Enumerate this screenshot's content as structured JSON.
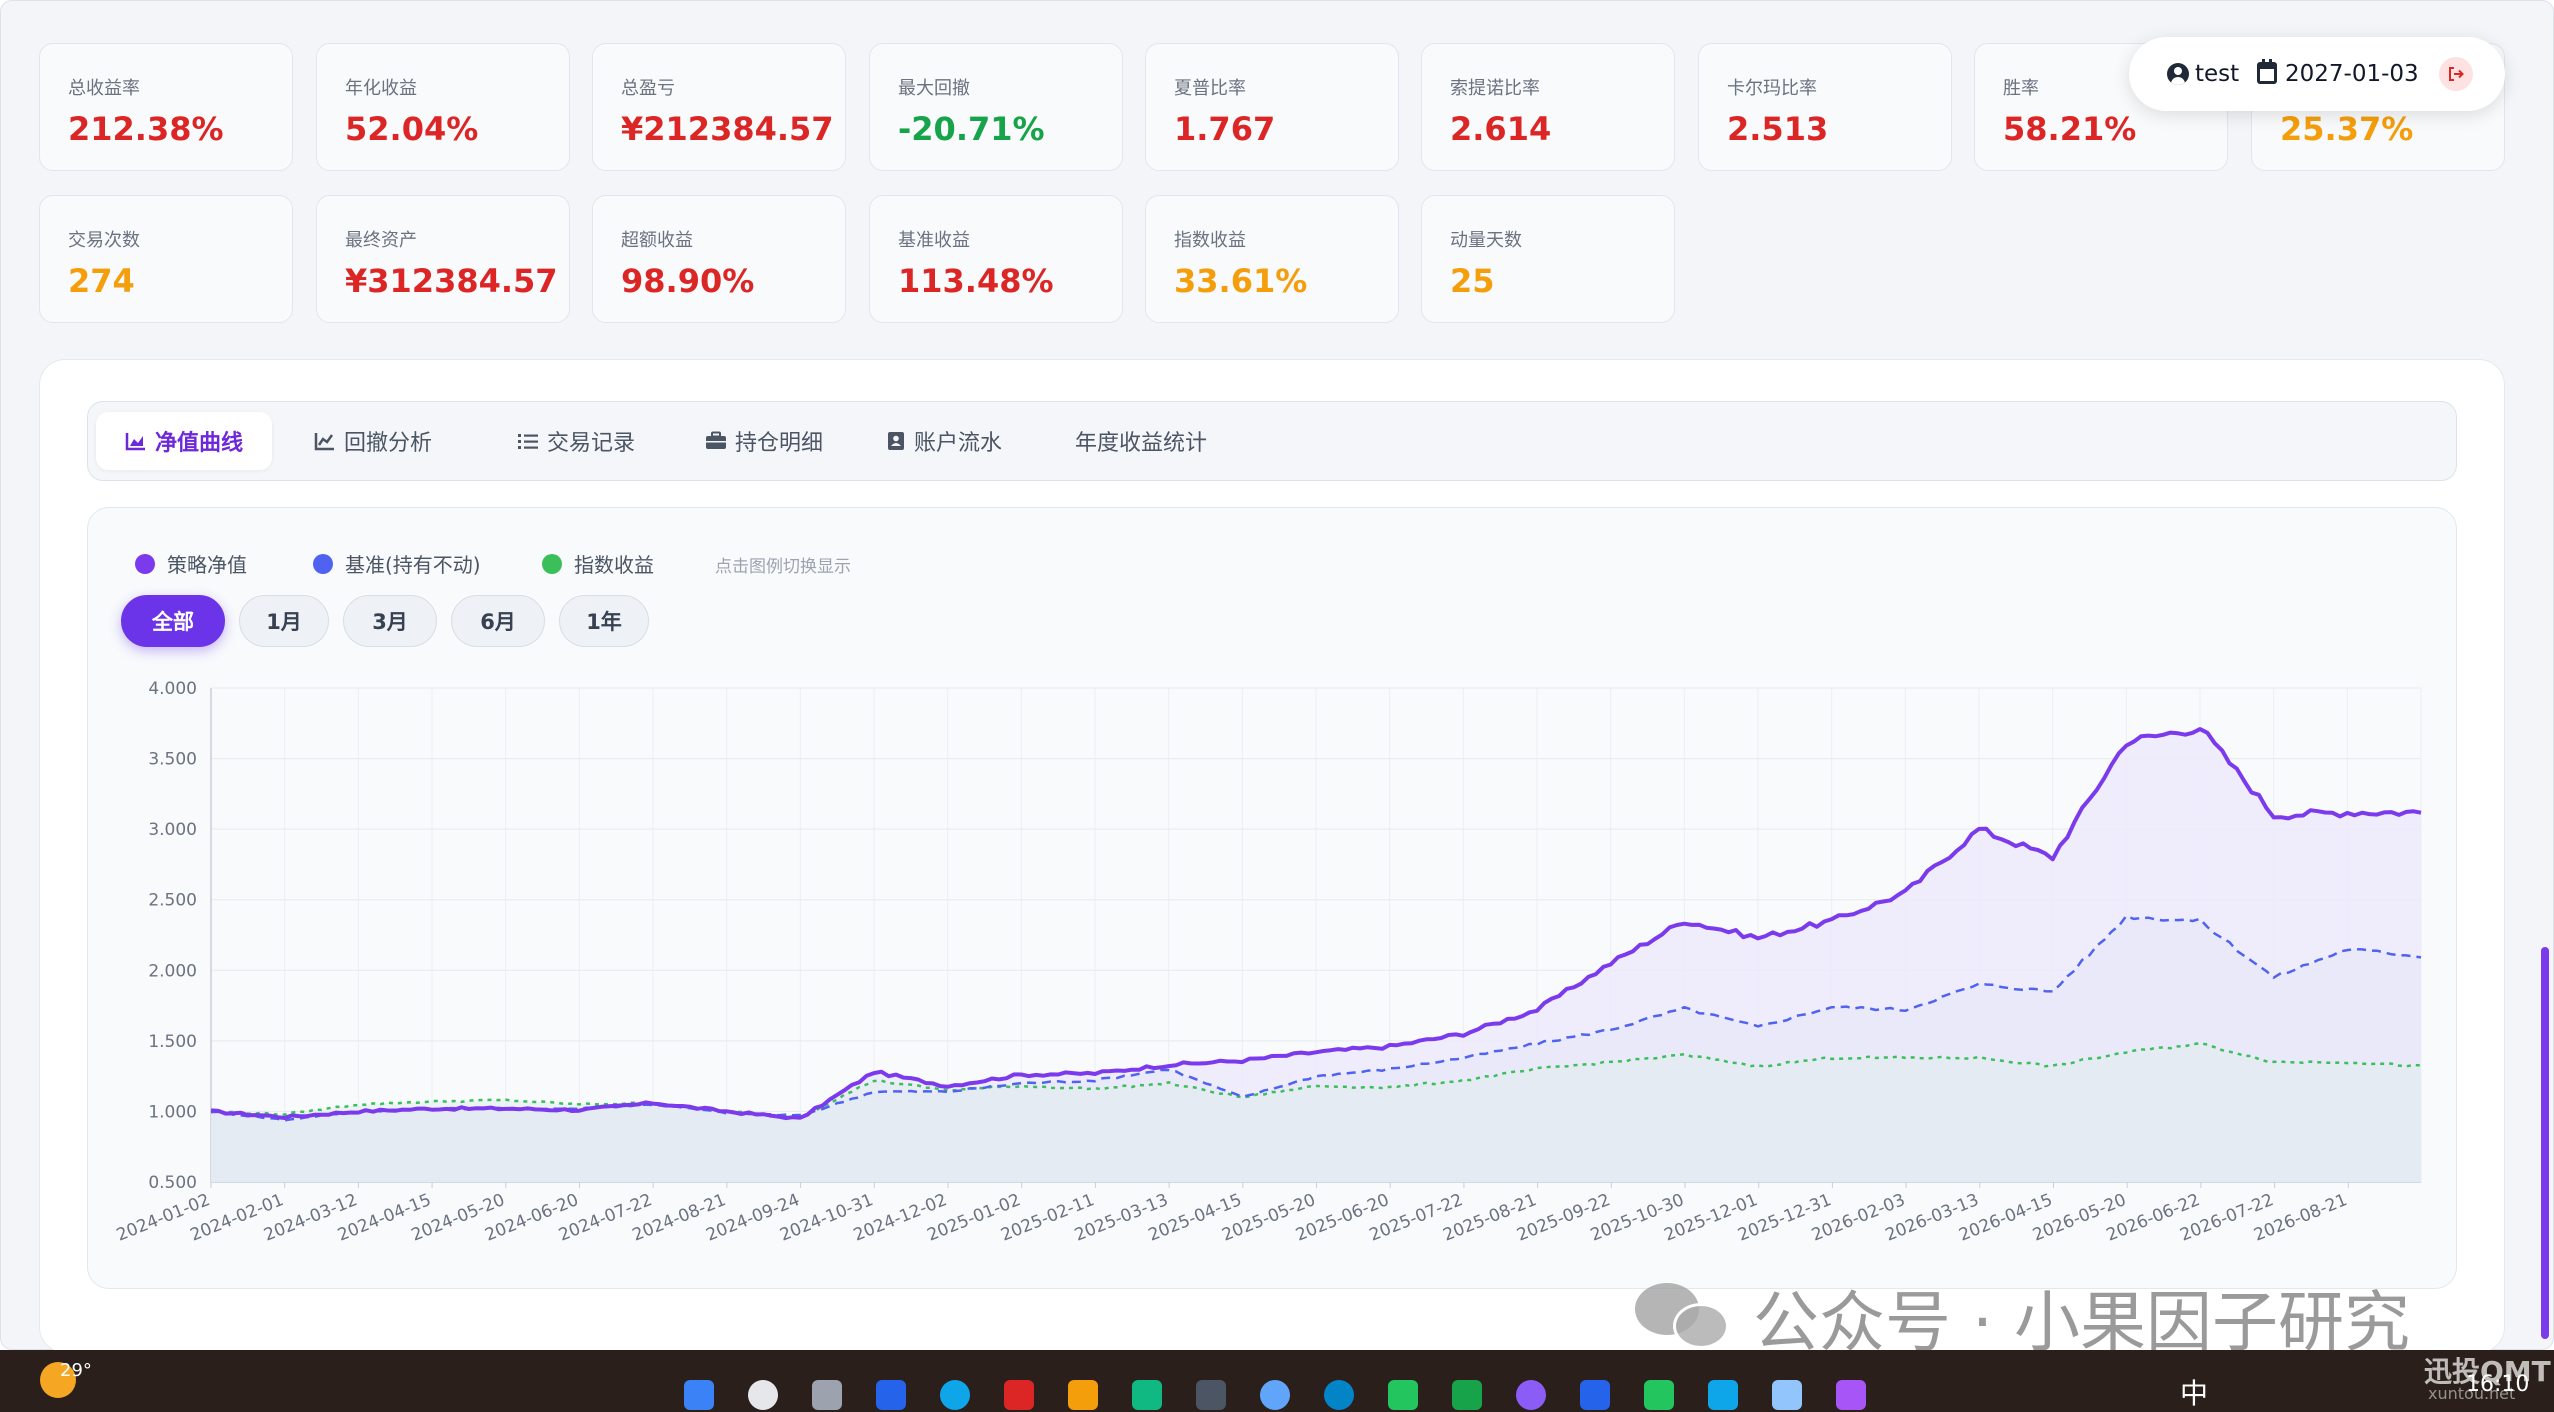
{
  "stats": [
    {
      "label": "总收益率",
      "value": "212.38%",
      "color": "#dc2626"
    },
    {
      "label": "年化收益",
      "value": "52.04%",
      "color": "#dc2626"
    },
    {
      "label": "总盈亏",
      "value": "¥212384.57",
      "color": "#dc2626"
    },
    {
      "label": "最大回撤",
      "value": "-20.71%",
      "color": "#16a34a"
    },
    {
      "label": "夏普比率",
      "value": "1.767",
      "color": "#dc2626"
    },
    {
      "label": "索提诺比率",
      "value": "2.614",
      "color": "#dc2626"
    },
    {
      "label": "卡尔玛比率",
      "value": "2.513",
      "color": "#dc2626"
    },
    {
      "label": "胜率",
      "value": "58.21%",
      "color": "#dc2626"
    },
    {
      "label": "",
      "value": "25.37%",
      "color": "#f59e0b"
    },
    {
      "label": "交易次数",
      "value": "274",
      "color": "#f59e0b"
    },
    {
      "label": "最终资产",
      "value": "¥312384.57",
      "color": "#dc2626"
    },
    {
      "label": "超额收益",
      "value": "98.90%",
      "color": "#dc2626"
    },
    {
      "label": "基准收益",
      "value": "113.48%",
      "color": "#dc2626"
    },
    {
      "label": "指数收益",
      "value": "33.61%",
      "color": "#f59e0b"
    },
    {
      "label": "动量天数",
      "value": "25",
      "color": "#f59e0b"
    }
  ],
  "user": {
    "name": "test",
    "date": "2027-01-03"
  },
  "tabs": [
    {
      "label": "净值曲线",
      "icon": "area-chart-icon",
      "active": true
    },
    {
      "label": "回撤分析",
      "icon": "line-chart-icon",
      "active": false
    },
    {
      "label": "交易记录",
      "icon": "list-icon",
      "active": false
    },
    {
      "label": "持仓明细",
      "icon": "briefcase-icon",
      "active": false
    },
    {
      "label": "账户流水",
      "icon": "ledger-icon",
      "active": false
    },
    {
      "label": "年度收益统计",
      "icon": "",
      "active": false
    }
  ],
  "legend": {
    "items": [
      {
        "label": "策略净值",
        "color": "#7c3aed"
      },
      {
        "label": "基准(持有不动)",
        "color": "#4f63f0"
      },
      {
        "label": "指数收益",
        "color": "#3bbf5a"
      }
    ],
    "hint": "点击图例切换显示"
  },
  "ranges": [
    "全部",
    "1月",
    "3月",
    "6月",
    "1年"
  ],
  "active_range": "全部",
  "chart_data": {
    "type": "line",
    "x_tick_labels": [
      "2024-01-02",
      "2024-02-01",
      "2024-03-12",
      "2024-04-15",
      "2024-05-20",
      "2024-06-20",
      "2024-07-22",
      "2024-08-21",
      "2024-09-24",
      "2024-10-31",
      "2024-12-02",
      "2025-01-02",
      "2025-02-11",
      "2025-03-13",
      "2025-04-15",
      "2025-05-20",
      "2025-06-20",
      "2025-07-22",
      "2025-08-21",
      "2025-09-22",
      "2025-10-30",
      "2025-12-01",
      "2025-12-31",
      "2026-02-03",
      "2026-03-13",
      "2026-04-15",
      "2026-05-20",
      "2026-06-22",
      "2026-07-22",
      "2026-08-21"
    ],
    "ylim": [
      0.5,
      4.0
    ],
    "y_ticks": [
      "0.500",
      "1.000",
      "1.500",
      "2.000",
      "2.500",
      "3.000",
      "3.500",
      "4.000"
    ],
    "grid": true,
    "series": [
      {
        "name": "策略净值",
        "color": "#7c3aed",
        "style": "solid",
        "values": [
          1.0,
          0.96,
          1.0,
          1.02,
          1.02,
          1.01,
          1.06,
          1.0,
          0.95,
          1.28,
          1.18,
          1.26,
          1.27,
          1.33,
          1.36,
          1.42,
          1.46,
          1.55,
          1.72,
          2.05,
          2.35,
          2.23,
          2.35,
          2.55,
          3.0,
          2.8,
          3.62,
          3.72,
          3.1,
          3.12,
          3.12
        ]
      },
      {
        "name": "基准(持有不动)",
        "color": "#4f63f0",
        "style": "dashed",
        "values": [
          1.0,
          0.94,
          1.0,
          1.02,
          1.02,
          1.02,
          1.05,
          0.99,
          0.97,
          1.14,
          1.14,
          1.2,
          1.22,
          1.3,
          1.1,
          1.25,
          1.3,
          1.38,
          1.48,
          1.58,
          1.73,
          1.6,
          1.74,
          1.72,
          1.9,
          1.85,
          2.38,
          2.35,
          1.95,
          2.15,
          2.1
        ]
      },
      {
        "name": "指数收益",
        "color": "#3bbf5a",
        "style": "dotted",
        "values": [
          1.0,
          0.98,
          1.05,
          1.07,
          1.08,
          1.05,
          1.06,
          1.0,
          0.96,
          1.22,
          1.15,
          1.18,
          1.16,
          1.2,
          1.1,
          1.18,
          1.17,
          1.22,
          1.3,
          1.35,
          1.4,
          1.32,
          1.38,
          1.38,
          1.38,
          1.32,
          1.42,
          1.48,
          1.35,
          1.35,
          1.32
        ]
      }
    ]
  },
  "watermark": "公众号 · 小果因子研究",
  "taskbar": {
    "temperature": "29°",
    "ime": "中",
    "time": "16:10",
    "brand": "迅投QMT",
    "brand_sub": "xuntou.net"
  }
}
